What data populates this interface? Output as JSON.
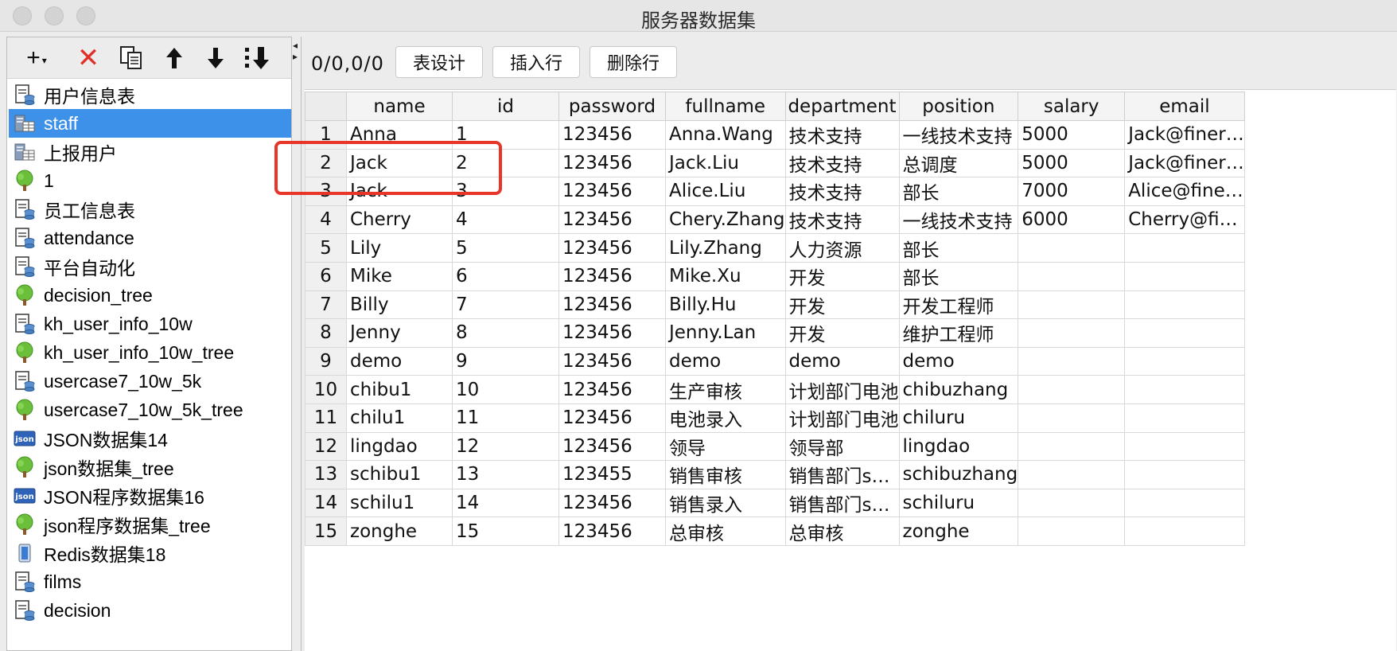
{
  "window": {
    "title": "服务器数据集"
  },
  "left_toolbar": {
    "icons": [
      "add-icon",
      "delete-icon",
      "copy-icon",
      "move-up-icon",
      "move-down-icon",
      "sort-icon"
    ],
    "delete_color": "#e0302a"
  },
  "tree": {
    "selected_index": 1,
    "items": [
      {
        "label": "用户信息表",
        "icon": "table-icon"
      },
      {
        "label": "staff",
        "icon": "server-table-icon"
      },
      {
        "label": "上报用户",
        "icon": "server-table-icon"
      },
      {
        "label": "1",
        "icon": "tree-icon"
      },
      {
        "label": "员工信息表",
        "icon": "table-icon"
      },
      {
        "label": "attendance",
        "icon": "table-icon"
      },
      {
        "label": "平台自动化",
        "icon": "table-icon"
      },
      {
        "label": "decision_tree",
        "icon": "tree-icon"
      },
      {
        "label": "kh_user_info_10w",
        "icon": "table-icon"
      },
      {
        "label": "kh_user_info_10w_tree",
        "icon": "tree-icon"
      },
      {
        "label": "usercase7_10w_5k",
        "icon": "table-icon"
      },
      {
        "label": "usercase7_10w_5k_tree",
        "icon": "tree-icon"
      },
      {
        "label": "JSON数据集14",
        "icon": "json-icon"
      },
      {
        "label": "json数据集_tree",
        "icon": "tree-icon"
      },
      {
        "label": "JSON程序数据集16",
        "icon": "json-icon"
      },
      {
        "label": "json程序数据集_tree",
        "icon": "tree-icon"
      },
      {
        "label": "Redis数据集18",
        "icon": "redis-icon"
      },
      {
        "label": "films",
        "icon": "table-icon"
      },
      {
        "label": "decision",
        "icon": "table-icon"
      }
    ]
  },
  "right_toolbar": {
    "counter": "0/0,0/0",
    "design_label": "表设计",
    "insert_label": "插入行",
    "delete_label": "删除行"
  },
  "table": {
    "columns": [
      "name",
      "id",
      "password",
      "fullname",
      "department",
      "position",
      "salary",
      "email"
    ],
    "rows": [
      [
        "1",
        "Anna",
        "1",
        "123456",
        "Anna.Wang",
        "技术支持",
        "一线技术支持",
        "5000",
        "Jack@finer…"
      ],
      [
        "2",
        "Jack",
        "2",
        "123456",
        "Jack.Liu",
        "技术支持",
        "总调度",
        "5000",
        "Jack@finer…"
      ],
      [
        "3",
        "Jack",
        "3",
        "123456",
        "Alice.Liu",
        "技术支持",
        "部长",
        "7000",
        "Alice@fine…"
      ],
      [
        "4",
        "Cherry",
        "4",
        "123456",
        "Chery.Zhang",
        "技术支持",
        "一线技术支持",
        "6000",
        "Cherry@fi…"
      ],
      [
        "5",
        "Lily",
        "5",
        "123456",
        "Lily.Zhang",
        "人力资源",
        "部长",
        "",
        ""
      ],
      [
        "6",
        "Mike",
        "6",
        "123456",
        "Mike.Xu",
        "开发",
        "部长",
        "",
        ""
      ],
      [
        "7",
        "Billy",
        "7",
        "123456",
        "Billy.Hu",
        "开发",
        "开发工程师",
        "",
        ""
      ],
      [
        "8",
        "Jenny",
        "8",
        "123456",
        "Jenny.Lan",
        "开发",
        "维护工程师",
        "",
        ""
      ],
      [
        "9",
        "demo",
        "9",
        "123456",
        "demo",
        "demo",
        "demo",
        "",
        ""
      ],
      [
        "10",
        "chibu1",
        "10",
        "123456",
        "生产审核",
        "计划部门电池",
        "chibuzhang",
        "",
        ""
      ],
      [
        "11",
        "chilu1",
        "11",
        "123456",
        "电池录入",
        "计划部门电池",
        "chiluru",
        "",
        ""
      ],
      [
        "12",
        "lingdao",
        "12",
        "123456",
        "领导",
        "领导部",
        "lingdao",
        "",
        ""
      ],
      [
        "13",
        "schibu1",
        "13",
        "123455",
        "销售审核",
        "销售部门s…",
        "schibuzhang",
        "",
        ""
      ],
      [
        "14",
        "schilu1",
        "14",
        "123456",
        "销售录入",
        "销售部门s…",
        "schiluru",
        "",
        ""
      ],
      [
        "15",
        "zonghe",
        "15",
        "123456",
        "总审核",
        "总审核",
        "zonghe",
        "",
        ""
      ]
    ],
    "highlighted_rows": [
      2,
      3
    ],
    "highlight_color": "#e8352b"
  },
  "colors": {
    "selection": "#3d91e8"
  }
}
